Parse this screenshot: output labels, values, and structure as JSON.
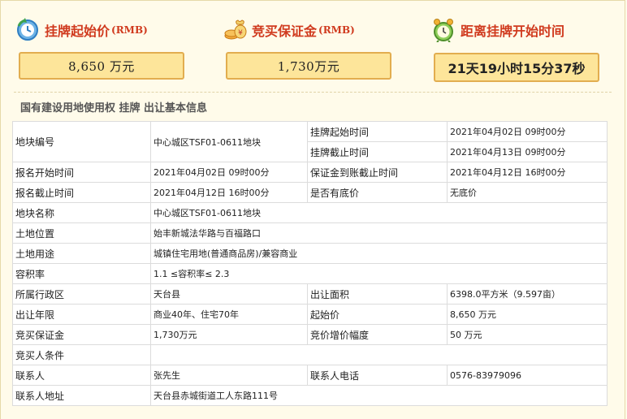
{
  "summary": {
    "start_price": {
      "label": "挂牌起始价",
      "unit_tag": "(RMB)",
      "value": "8,650  万元",
      "icon": "clock-refresh-icon"
    },
    "deposit": {
      "label": "竞买保证金",
      "unit_tag": "(RMB)",
      "value": "1,730万元",
      "icon": "coins-bag-icon"
    },
    "countdown": {
      "label": "距离挂牌开始时间",
      "value": "21天19小时15分37秒",
      "icon": "alarm-clock-icon"
    }
  },
  "section_title": "国有建设用地使用权 挂牌 出让基本信息",
  "table": {
    "r1": {
      "k1": "地块编号",
      "v1": "中心城区TSF01-0611地块",
      "k2": "挂牌起始时间",
      "v2": "2021年04月02日 09时00分"
    },
    "r1b": {
      "k2": "挂牌截止时间",
      "v2": "2021年04月13日 09时00分"
    },
    "r2": {
      "k1": "报名开始时间",
      "v1": "2021年04月02日 09时00分",
      "k2": "保证金到账截止时间",
      "v2": "2021年04月12日 16时00分"
    },
    "r3": {
      "k1": "报名截止时间",
      "v1": "2021年04月12日 16时00分",
      "k2": "是否有底价",
      "v2": "无底价"
    },
    "r4": {
      "k1": "地块名称",
      "v1": "中心城区TSF01-0611地块"
    },
    "r5": {
      "k1": "土地位置",
      "v1": "始丰新城法华路与百福路口"
    },
    "r6": {
      "k1": "土地用途",
      "v1": "城镇住宅用地(普通商品房)/兼容商业"
    },
    "r7": {
      "k1": "容积率",
      "v1": "1.1 ≤容积率≤ 2.3"
    },
    "r8": {
      "k1": "所属行政区",
      "v1": "天台县",
      "k2": "出让面积",
      "v2": "6398.0平方米（9.597亩）"
    },
    "r9": {
      "k1": "出让年限",
      "v1": "商业40年、住宅70年",
      "k2": "起始价",
      "v2": "8,650 万元"
    },
    "r10": {
      "k1": "竞买保证金",
      "v1": "1,730万元",
      "k2": "竞价增价幅度",
      "v2": "50 万元"
    },
    "r11": {
      "k1": "竞买人条件",
      "v1": ""
    },
    "r12": {
      "k1": "联系人",
      "v1": "张先生",
      "k2": "联系人电话",
      "v2": "0576-83979096"
    },
    "r13": {
      "k1": "联系人地址",
      "v1": "天台县赤城街道工人东路111号"
    }
  }
}
